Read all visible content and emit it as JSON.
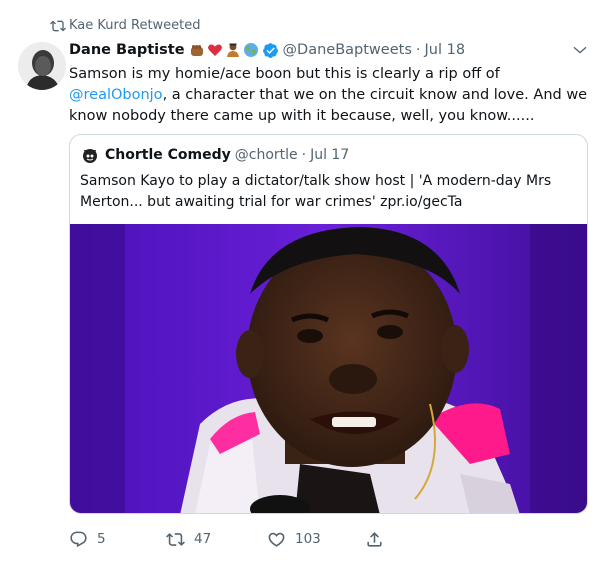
{
  "retweet_banner": {
    "text": "Kae Kurd Retweeted",
    "icon": "retweet-icon"
  },
  "tweet": {
    "author_name": "Dane Baptiste",
    "emojis": [
      "fist-emoji",
      "heart-emoji",
      "person-emoji",
      "earth-emoji"
    ],
    "verified": true,
    "handle": "@DaneBaptweets",
    "separator": "·",
    "date": "Jul 18",
    "text_before_mention": "Samson is my homie/ace boon but this is clearly a rip off of ",
    "mention": "@realObonjo",
    "text_after_mention": ", a character that we on the circuit know and love. And we know nobody there came up with it because, well, you know......",
    "menu_icon": "chevron-down-icon"
  },
  "quote": {
    "author_name": "Chortle Comedy",
    "handle": "@chortle",
    "separator": "·",
    "date": "Jul 17",
    "text": "Samson Kayo to play a dictator/talk show host | 'A modern-day Mrs Merton... but awaiting trial for war crimes' zpr.io/gecTa"
  },
  "actions": {
    "reply_count": "5",
    "retweet_count": "47",
    "like_count": "103"
  },
  "colors": {
    "accent": "#1d9bf0",
    "secondary_text": "#536471",
    "border": "#cfd9de",
    "photo_backdrop": "#5a18c8",
    "jacket_pink": "#ff1493"
  }
}
